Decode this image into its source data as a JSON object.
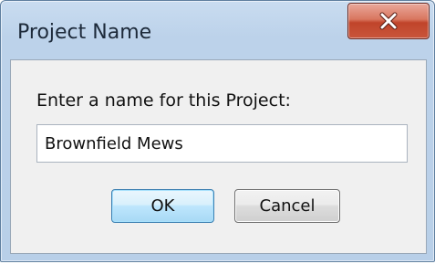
{
  "window": {
    "title": "Project Name",
    "close_icon": "close-x-icon"
  },
  "form": {
    "prompt_label": "Enter a name for this Project:",
    "name_value": "Brownfield Mews"
  },
  "buttons": {
    "ok_label": "OK",
    "cancel_label": "Cancel"
  },
  "colors": {
    "titlebar": "#bcd2ea",
    "close_button": "#c9553b",
    "default_button_border": "#3c7fb1"
  }
}
